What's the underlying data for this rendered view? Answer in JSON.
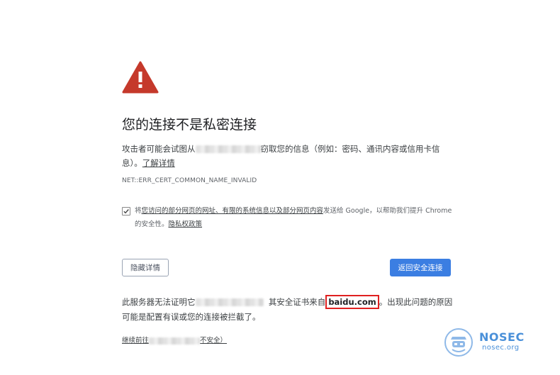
{
  "page": {
    "heading": "您的连接不是私密连接",
    "warning_part1": "攻击者可能会试图从",
    "warning_part2": "窃取您的信息（例如：密码、通讯内容或信用卡信息）。",
    "learn_more": "了解详情",
    "error_code": "NET::ERR_CERT_COMMON_NAME_INVALID",
    "checkbox": {
      "checked": true,
      "text_prefix": "将",
      "text_link": "您访问的部分网页的网址、有限的系统信息以及部分网页内容",
      "text_suffix": "发送给 Google，以帮助我们提升 Chrome 的安全性。",
      "privacy_link": "隐私权政策"
    },
    "hide_details_button": "隐藏详情",
    "back_to_safety_button": "返回安全连接",
    "details_part1": "此服务器无法证明它",
    "details_part2": "其安全证书来自",
    "details_highlight": "baidu.com",
    "details_part3": "。出现此问题的原因可能是配置有误或您的连接被拦截了。",
    "proceed_link_prefix": "继续前往",
    "proceed_link_suffix": "不安全）"
  },
  "watermark": {
    "title": "NOSEC",
    "subtitle": "nosec.org"
  },
  "colors": {
    "warning_red": "#c5392b",
    "primary_blue": "#3b7ee2",
    "highlight_box": "#e02020",
    "watermark_blue": "#4a90d9"
  }
}
